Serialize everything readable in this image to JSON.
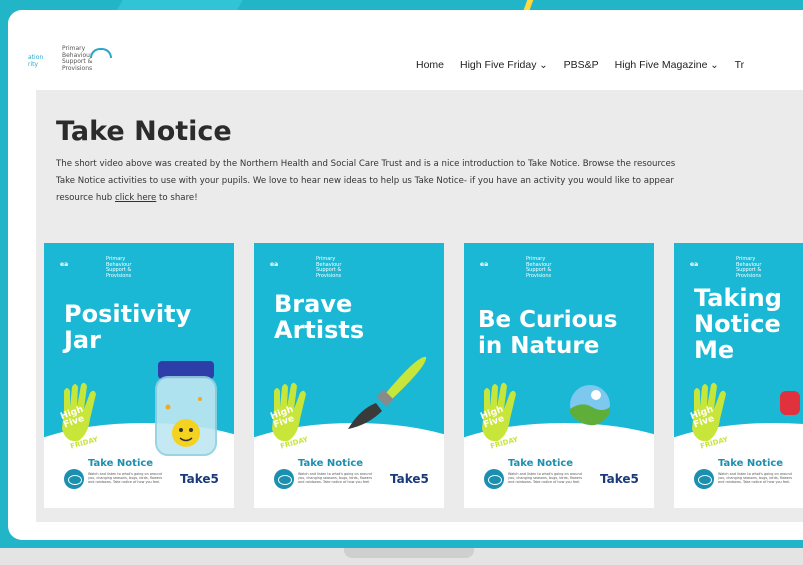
{
  "nav": {
    "logo_left": "ation\nrity",
    "logo_right": "Primary\nBehaviour\nSupport &\nProvisions",
    "links": [
      {
        "label": "Home",
        "dropdown": false
      },
      {
        "label": "High Five Friday",
        "dropdown": true
      },
      {
        "label": "PBS&P",
        "dropdown": false
      },
      {
        "label": "High Five Magazine",
        "dropdown": true
      },
      {
        "label": "Tr",
        "dropdown": false
      }
    ]
  },
  "main": {
    "title": "Take Notice",
    "para_line1": "The short video above was created by the Northern Health and Social Care Trust and is a nice introduction to Take Notice. Browse the resources",
    "para_line2": "Take Notice activities to use with your pupils. We love to hear new ideas to help us Take Notice- if you have an activity you would like to appear",
    "para_line3_pre": "resource hub ",
    "para_link": "click here",
    "para_line3_post": " to share!"
  },
  "cards": [
    {
      "title_l1": "Positivity",
      "title_l2": "Jar",
      "illustration": "jar-icon"
    },
    {
      "title_l1": "Brave",
      "title_l2": "Artists",
      "illustration": "paintbrush-icon"
    },
    {
      "title_l1": "Be Curious",
      "title_l2": "in Nature",
      "illustration": "globe-icon"
    },
    {
      "title_l1": "Taking",
      "title_l2": "Notice",
      "title_l3": "Me",
      "illustration": "heart-icon"
    }
  ],
  "card_common": {
    "logo": "ea",
    "logo_sub": "Primary\nBehaviour\nSupport &\nProvisions",
    "hand_l1": "High",
    "hand_l2": "Five",
    "hand_l3": "FRIDAY",
    "take_notice": "Take Notice",
    "take_notice_text": "Watch and listen to what's going on around you, changing seasons, bugs, birds, flowers and rainbows. Take notice of how you feel.",
    "take5": "Take5"
  },
  "colors": {
    "background": "#22b5c8",
    "card": "#1ab8d4",
    "accent": "#1a8fb0",
    "hand": "#c8e63a"
  }
}
